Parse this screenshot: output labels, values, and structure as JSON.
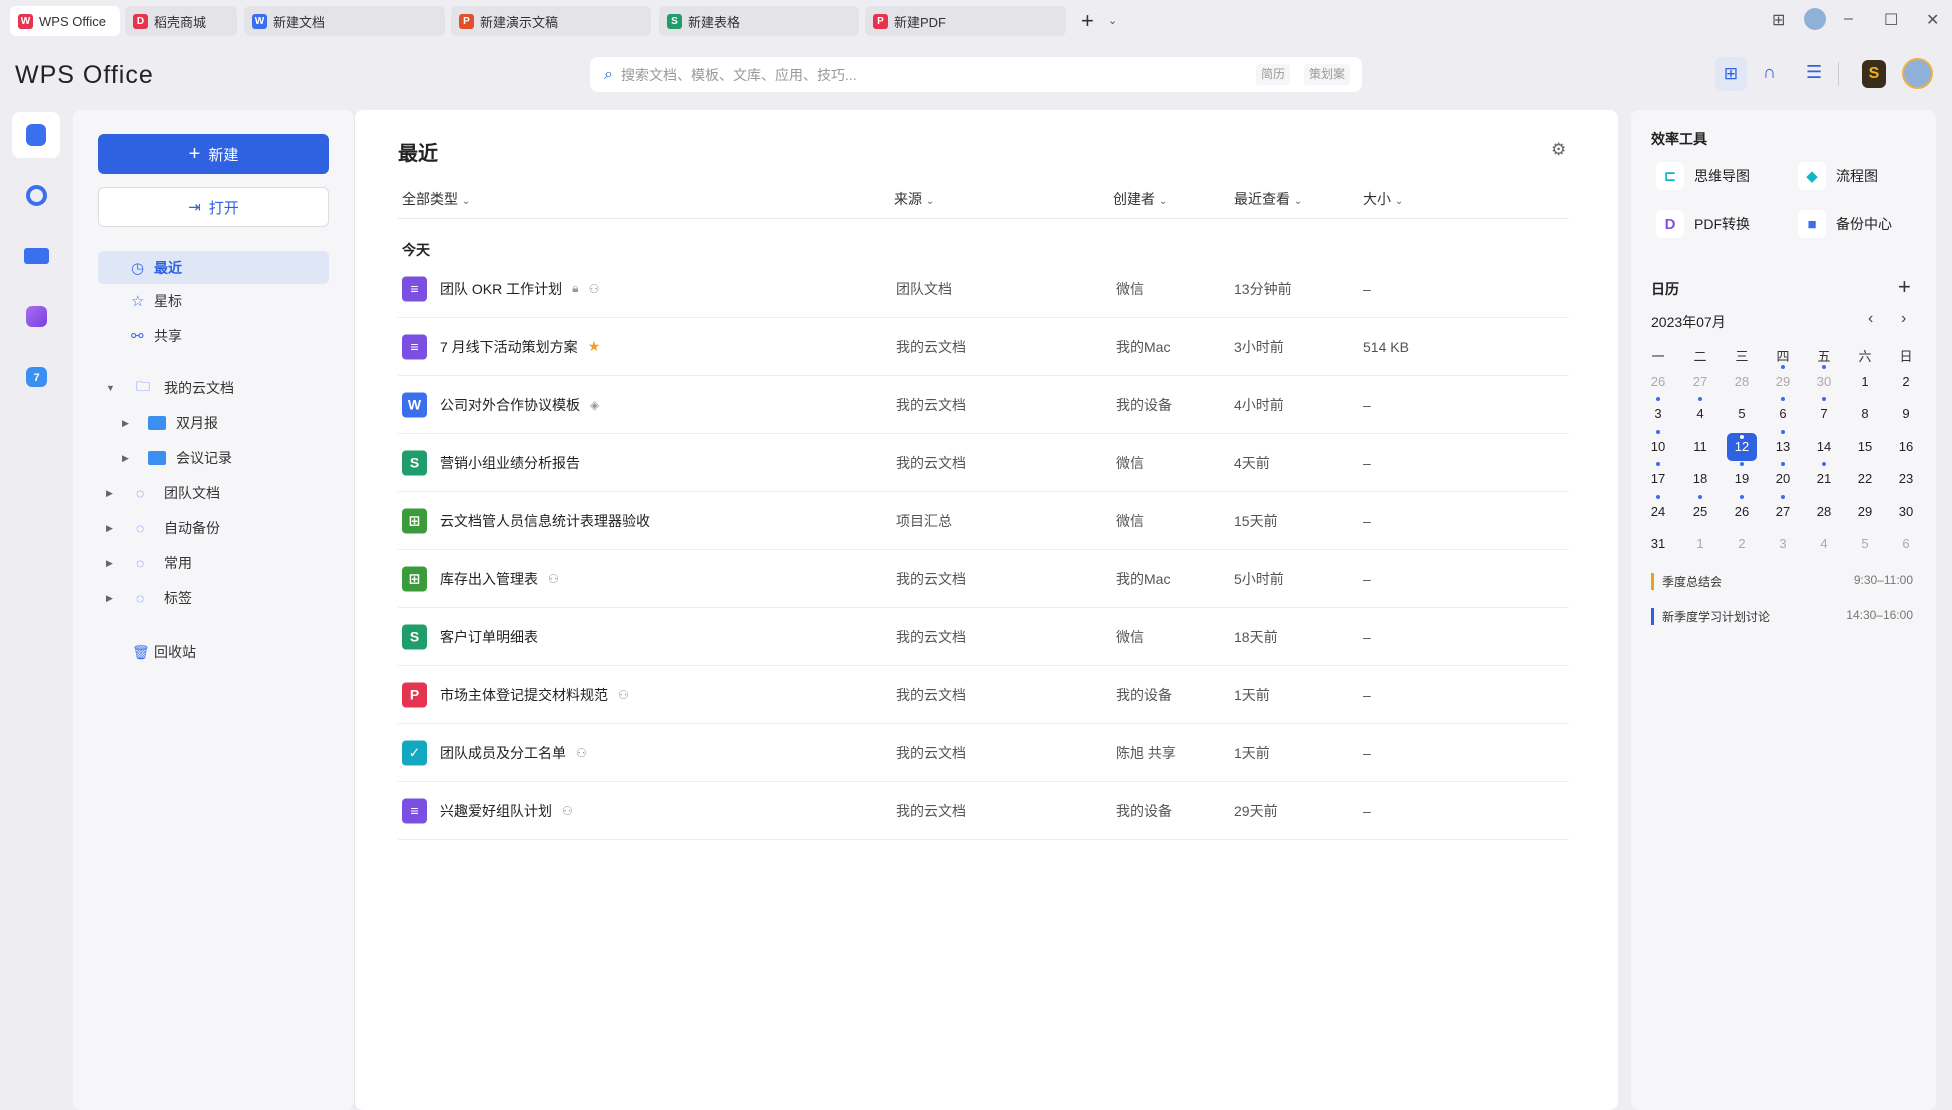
{
  "tabs": [
    {
      "label": "WPS Office",
      "icon": "W",
      "color": "#e5344f",
      "active": true
    },
    {
      "label": "稻壳商城",
      "icon": "D",
      "color": "#e5344f"
    },
    {
      "label": "新建文档",
      "icon": "W",
      "color": "#3a6ff0"
    },
    {
      "label": "新建演示文稿",
      "icon": "P",
      "color": "#e0502c"
    },
    {
      "label": "新建表格",
      "icon": "S",
      "color": "#1f9d6b"
    },
    {
      "label": "新建PDF",
      "icon": "P",
      "color": "#e5344f"
    }
  ],
  "app": {
    "logo": "WPS Office"
  },
  "search": {
    "placeholder": "搜索文档、模板、文库、应用、技巧...",
    "chips": [
      "简历",
      "策划案"
    ]
  },
  "sidebar": {
    "new_label": "新建",
    "open_label": "打开",
    "nav": [
      {
        "label": "最近",
        "icon": "clock-icon",
        "glyph": "◷",
        "selected": true
      },
      {
        "label": "星标",
        "icon": "star-icon",
        "glyph": "☆"
      },
      {
        "label": "共享",
        "icon": "share-icon",
        "glyph": "⚯"
      }
    ],
    "tree": [
      {
        "label": "我的云文档",
        "icon": "folder-outline-icon",
        "expanded": true,
        "children": [
          {
            "label": "双月报"
          },
          {
            "label": "会议记录"
          }
        ]
      },
      {
        "label": "团队文档",
        "icon": "team-icon"
      },
      {
        "label": "自动备份",
        "icon": "cloud-upload-icon"
      },
      {
        "label": "常用",
        "icon": "pin-icon"
      },
      {
        "label": "标签",
        "icon": "tag-icon"
      }
    ],
    "trash": "回收站"
  },
  "main": {
    "title": "最近",
    "columns": [
      "全部类型",
      "来源",
      "创建者",
      "最近查看",
      "大小"
    ],
    "group": "今天",
    "rows": [
      {
        "type": "doc",
        "name": "团队 OKR 工作计划",
        "marks": [
          "lock-icon",
          "team-icon"
        ],
        "source": "团队文档",
        "creator": "微信",
        "viewed": "13分钟前",
        "size": "–"
      },
      {
        "type": "doc",
        "name": "7 月线下活动策划方案",
        "marks": [
          "star-icon"
        ],
        "source": "我的云文档",
        "creator": "我的Mac",
        "viewed": "3小时前",
        "size": "514 KB"
      },
      {
        "type": "word",
        "name": "公司对外合作协议模板",
        "marks": [
          "shield-icon"
        ],
        "source": "我的云文档",
        "creator": "我的设备",
        "viewed": "4小时前",
        "size": "–"
      },
      {
        "type": "sheet",
        "name": "营销小组业绩分析报告",
        "marks": [],
        "source": "我的云文档",
        "creator": "微信",
        "viewed": "4天前",
        "size": "–"
      },
      {
        "type": "table",
        "name": "云文档管人员信息统计表理器验收",
        "marks": [],
        "source": "项目汇总",
        "creator": "微信",
        "viewed": "15天前",
        "size": "–"
      },
      {
        "type": "table",
        "name": "库存出入管理表",
        "marks": [
          "team-icon"
        ],
        "source": "我的云文档",
        "creator": "我的Mac",
        "viewed": "5小时前",
        "size": "–"
      },
      {
        "type": "sheet",
        "name": "客户订单明细表",
        "marks": [],
        "source": "我的云文档",
        "creator": "微信",
        "viewed": "18天前",
        "size": "–"
      },
      {
        "type": "pdf",
        "name": "市场主体登记提交材料规范",
        "marks": [
          "team-icon"
        ],
        "source": "我的云文档",
        "creator": "我的设备",
        "viewed": "1天前",
        "size": "–"
      },
      {
        "type": "form",
        "name": "团队成员及分工名单",
        "marks": [
          "team-icon"
        ],
        "source": "我的云文档",
        "creator": "陈旭 共享",
        "viewed": "1天前",
        "size": "–"
      },
      {
        "type": "doc",
        "name": "兴趣爱好组队计划",
        "marks": [
          "team-icon"
        ],
        "source": "我的云文档",
        "creator": "我的设备",
        "viewed": "29天前",
        "size": "–"
      }
    ]
  },
  "filetypes": {
    "doc": {
      "glyph": "≡",
      "color": "#7b4fe0"
    },
    "word": {
      "glyph": "W",
      "color": "#3a6ff0"
    },
    "sheet": {
      "glyph": "S",
      "color": "#1f9d6b"
    },
    "table": {
      "glyph": "⊞",
      "color": "#3b9b3a"
    },
    "pdf": {
      "glyph": "P",
      "color": "#e5344f"
    },
    "form": {
      "glyph": "✓",
      "color": "#13a8c0"
    }
  },
  "tools": {
    "title": "效率工具",
    "items": [
      {
        "label": "思维导图",
        "icon": "mindmap-icon",
        "glyph": "⊏",
        "color": "#13b5c8"
      },
      {
        "label": "流程图",
        "icon": "flowchart-icon",
        "glyph": "◆",
        "color": "#13b5c8"
      },
      {
        "label": "PDF转换",
        "icon": "pdf-convert-icon",
        "glyph": "D",
        "color": "#8a4fe0"
      },
      {
        "label": "备份中心",
        "icon": "backup-folder-icon",
        "glyph": "■",
        "color": "#3a6ff0"
      }
    ]
  },
  "calendar": {
    "title": "日历",
    "month": "2023年07月",
    "weekdays": [
      "一",
      "二",
      "三",
      "四",
      "五",
      "六",
      "日"
    ],
    "weeks": [
      [
        26,
        27,
        28,
        29,
        30,
        1,
        2
      ],
      [
        3,
        4,
        5,
        6,
        7,
        8,
        9
      ],
      [
        10,
        11,
        12,
        13,
        14,
        15,
        16
      ],
      [
        17,
        18,
        19,
        20,
        21,
        22,
        23
      ],
      [
        24,
        25,
        26,
        27,
        28,
        29,
        30
      ],
      [
        31,
        1,
        2,
        3,
        4,
        5,
        6
      ]
    ],
    "muted": [
      [
        0,
        0
      ],
      [
        0,
        1
      ],
      [
        0,
        2
      ],
      [
        0,
        3
      ],
      [
        0,
        4
      ],
      [
        5,
        1
      ],
      [
        5,
        2
      ],
      [
        5,
        3
      ],
      [
        5,
        4
      ],
      [
        5,
        5
      ],
      [
        5,
        6
      ]
    ],
    "today": [
      2,
      2
    ],
    "event_days": [
      [
        0,
        3
      ],
      [
        0,
        4
      ],
      [
        1,
        0
      ],
      [
        1,
        1
      ],
      [
        1,
        3
      ],
      [
        1,
        4
      ],
      [
        2,
        0
      ],
      [
        2,
        2
      ],
      [
        2,
        3
      ],
      [
        3,
        0
      ],
      [
        3,
        2
      ],
      [
        3,
        3
      ],
      [
        3,
        4
      ],
      [
        4,
        0
      ],
      [
        4,
        1
      ],
      [
        4,
        2
      ],
      [
        4,
        3
      ]
    ],
    "events": [
      {
        "title": "季度总结会",
        "time": "9:30–11:00",
        "color": "#e8a020"
      },
      {
        "title": "新季度学习计划讨论",
        "time": "14:30–16:00",
        "color": "#2f62e0"
      }
    ]
  },
  "colors": {
    "accent": "#2f62e0"
  }
}
